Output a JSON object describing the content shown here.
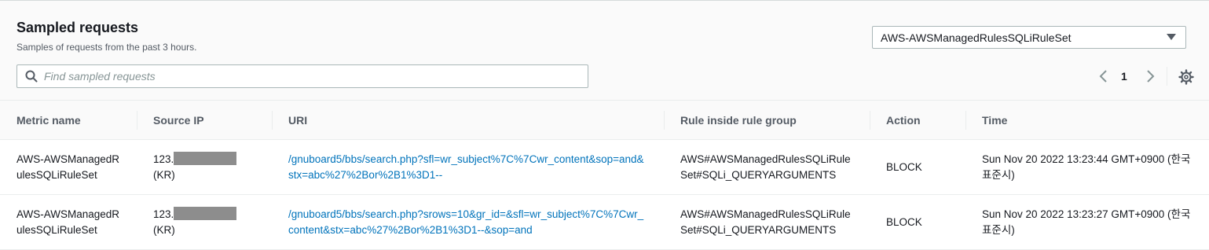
{
  "header": {
    "title": "Sampled requests",
    "subtitle": "Samples of requests from the past 3 hours."
  },
  "rule_select": {
    "value": "AWS-AWSManagedRulesSQLiRuleSet"
  },
  "search": {
    "placeholder": "Find sampled requests",
    "value": ""
  },
  "pagination": {
    "current_page": "1"
  },
  "table": {
    "columns": [
      "Metric name",
      "Source IP",
      "URI",
      "Rule inside rule group",
      "Action",
      "Time"
    ],
    "rows": [
      {
        "metric_name": "AWS-AWSManagedRulesSQLiRuleSet",
        "source_ip_prefix": "123.",
        "source_country": "(KR)",
        "uri": "/gnuboard5/bbs/search.php?sfl=wr_subject%7C%7Cwr_content&sop=and&stx=abc%27%2Bor%2B1%3D1--",
        "rule": "AWS#AWSManagedRulesSQLiRuleSet#SQLi_QUERYARGUMENTS",
        "action": "BLOCK",
        "time": "Sun Nov 20 2022 13:23:44 GMT+0900 (한국 표준시)"
      },
      {
        "metric_name": "AWS-AWSManagedRulesSQLiRuleSet",
        "source_ip_prefix": "123.",
        "source_country": "(KR)",
        "uri": "/gnuboard5/bbs/search.php?srows=10&gr_id=&sfl=wr_subject%7C%7Cwr_content&stx=abc%27%2Bor%2B1%3D1--&sop=and",
        "rule": "AWS#AWSManagedRulesSQLiRuleSet#SQLi_QUERYARGUMENTS",
        "action": "BLOCK",
        "time": "Sun Nov 20 2022 13:23:27 GMT+0900 (한국 표준시)"
      }
    ]
  },
  "icons": {
    "search": "search-icon",
    "prev": "chevron-left-icon",
    "next": "chevron-right-icon",
    "settings": "gear-icon",
    "caret": "caret-down-icon"
  },
  "colors": {
    "link": "#0073bb",
    "header_bg": "#fafafa",
    "border": "#eaeded",
    "redaction": "#8d8d8d"
  }
}
